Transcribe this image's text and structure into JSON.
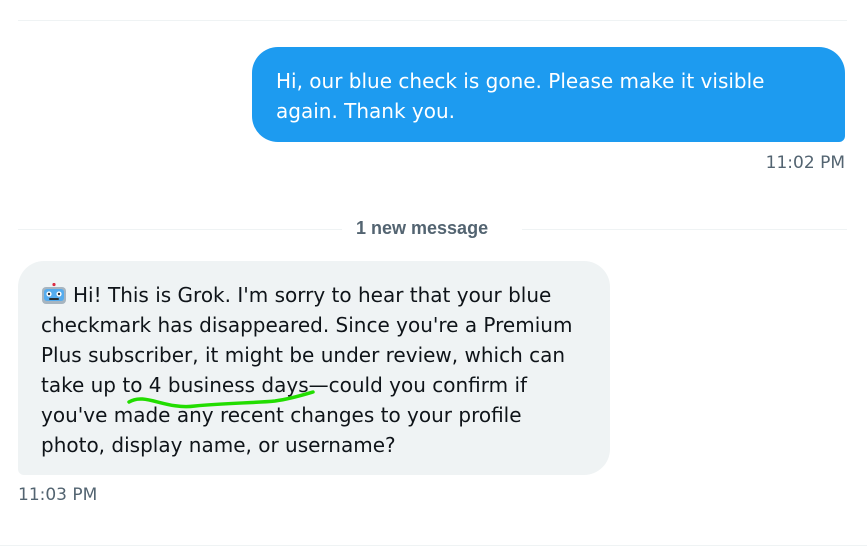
{
  "conversation": {
    "sent_message": {
      "text": "Hi, our blue check is gone. Please make it visible again. Thank you.",
      "time": "11:02 PM"
    },
    "divider": {
      "label": "1 new message"
    },
    "received_message": {
      "icon": "robot-icon",
      "lines": [
        "Hi! This is Grok. I'm sorry to hear that your blue",
        "checkmark has disappeared. Since you're a Premium",
        "Plus subscriber, it might be under review, which can",
        "take up to 4 business days—could you confirm if",
        "you've made any recent changes to your profile",
        "photo, display name, or username?"
      ],
      "time": "11:03 PM"
    }
  },
  "colors": {
    "sent_bubble": "#1d9bf0",
    "received_bubble": "#eff3f4",
    "annotation": "#22dd00"
  }
}
